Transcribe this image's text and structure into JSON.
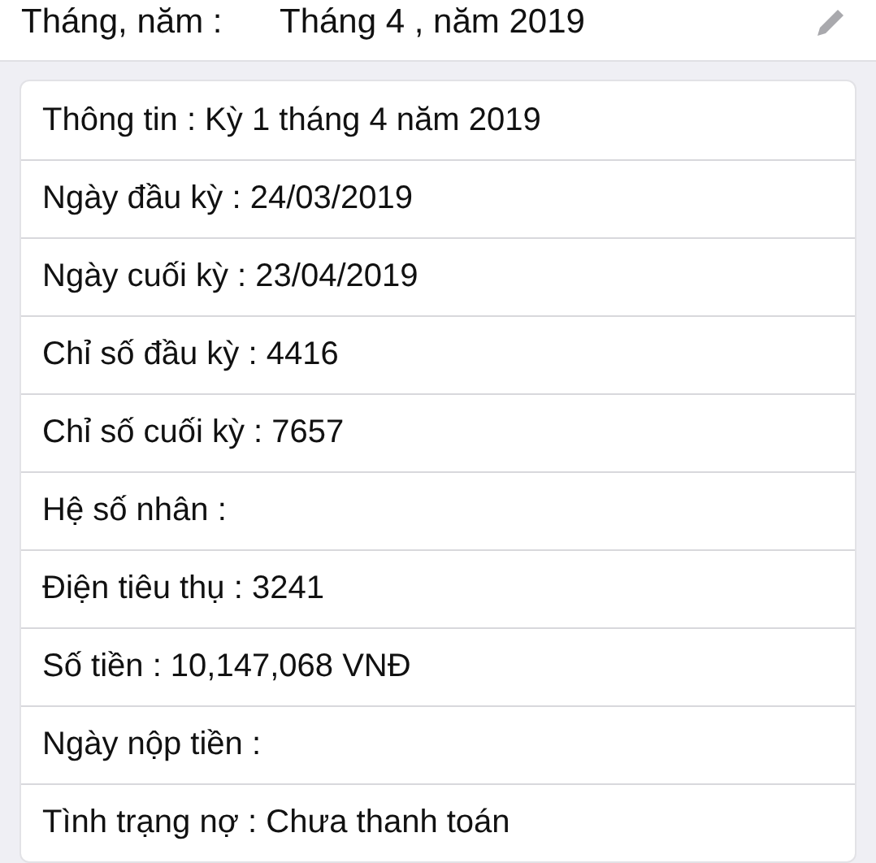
{
  "period": {
    "label": "Tháng, năm :",
    "value": "Tháng 4 , năm 2019"
  },
  "rows": [
    "Thông tin : Kỳ 1 tháng 4 năm 2019",
    "Ngày đầu kỳ : 24/03/2019",
    "Ngày cuối kỳ : 23/04/2019",
    "Chỉ số đầu kỳ : 4416",
    "Chỉ số cuối kỳ : 7657",
    "Hệ số nhân :",
    "Điện tiêu thụ : 3241",
    "Số tiền : 10,147,068 VNĐ",
    "Ngày nộp tiền :",
    "Tình trạng nợ : Chưa thanh toán"
  ]
}
